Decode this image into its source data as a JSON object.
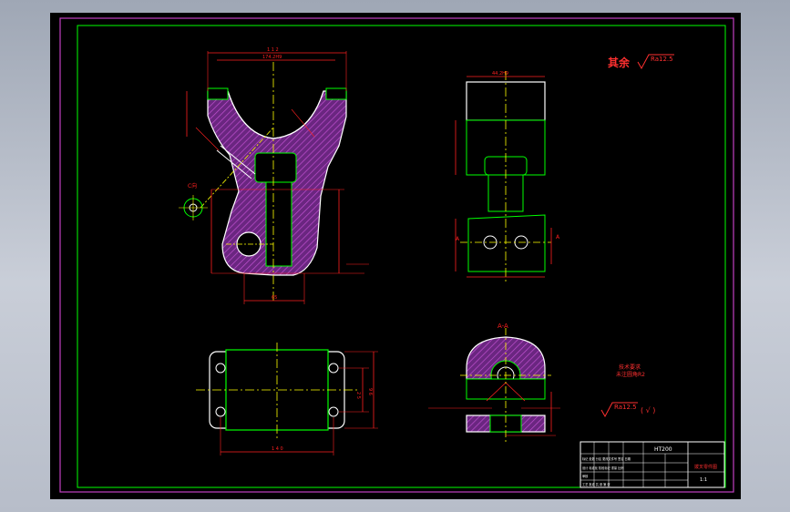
{
  "drawing": {
    "roughness_note": "其余",
    "roughness_value_main": "Ra12.5",
    "roughness_value_note": "Ra12.5",
    "roughness_paren": "( √ )",
    "tech_req_line1": "技术要求",
    "tech_req_line2": "未注圆角R2",
    "section_label": "A-A",
    "view_c_label": "C向",
    "label_A_left": "A",
    "label_A_right": "A"
  },
  "dimensions": {
    "front_top_overall": "1 1 2",
    "front_top_fit": "174.2H9",
    "side_top_width": "44.2H9",
    "plan_bottom_width": "1 4 0",
    "front_bottom_width": "65",
    "plan_right_height": "2 5",
    "plan_right_outer": "9 6"
  },
  "title_block": {
    "material": "HT200",
    "part_name": "拨叉零件图",
    "scale": "1:1",
    "row1": "标记 处数 分区 更改文件号 签名 日期",
    "row2": "设计 标准化 阶段标记 重量 比例",
    "row3": "审核",
    "row4": "工艺 批准 共 张 第 张"
  },
  "colors": {
    "frame_magenta": "#c040c0",
    "border_green": "#00ff00",
    "outline_white": "#ffffff",
    "hatch_magenta": "#9933aa",
    "dimension_red": "#ff2020",
    "centerline_yellow": "#ffff00",
    "text_red": "#ff3030"
  }
}
